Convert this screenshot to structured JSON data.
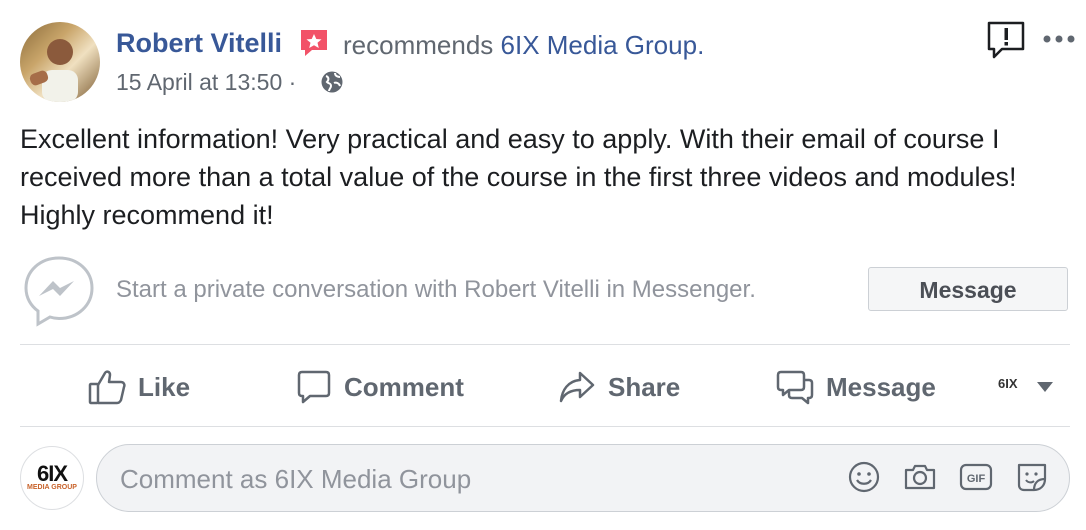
{
  "post": {
    "author": "Robert Vitelli",
    "action_text": "recommends",
    "page_name": "6IX Media Group.",
    "timestamp": "15 April at 13:50",
    "separator": "·",
    "body": "Excellent information! Very practical and easy to apply. With their email of course I received more than a total value of the course in the first three videos and modules! Highly recommend it!"
  },
  "messenger_prompt": {
    "text": "Start a private conversation with Robert Vitelli in Messenger.",
    "button_label": "Message"
  },
  "actions": {
    "like": "Like",
    "comment": "Comment",
    "share": "Share",
    "message": "Message",
    "page_mini_logo": "6IX"
  },
  "comment_composer": {
    "placeholder": "Comment as 6IX Media Group",
    "avatar_logo": "6IX",
    "avatar_sub": "MEDIA GROUP",
    "icons": [
      "emoji-icon",
      "camera-icon",
      "gif-icon",
      "sticker-icon"
    ]
  },
  "colors": {
    "link": "#385898",
    "secondary_text": "#606770",
    "recommend_badge": "#f25268",
    "divider": "#dddfe2"
  }
}
